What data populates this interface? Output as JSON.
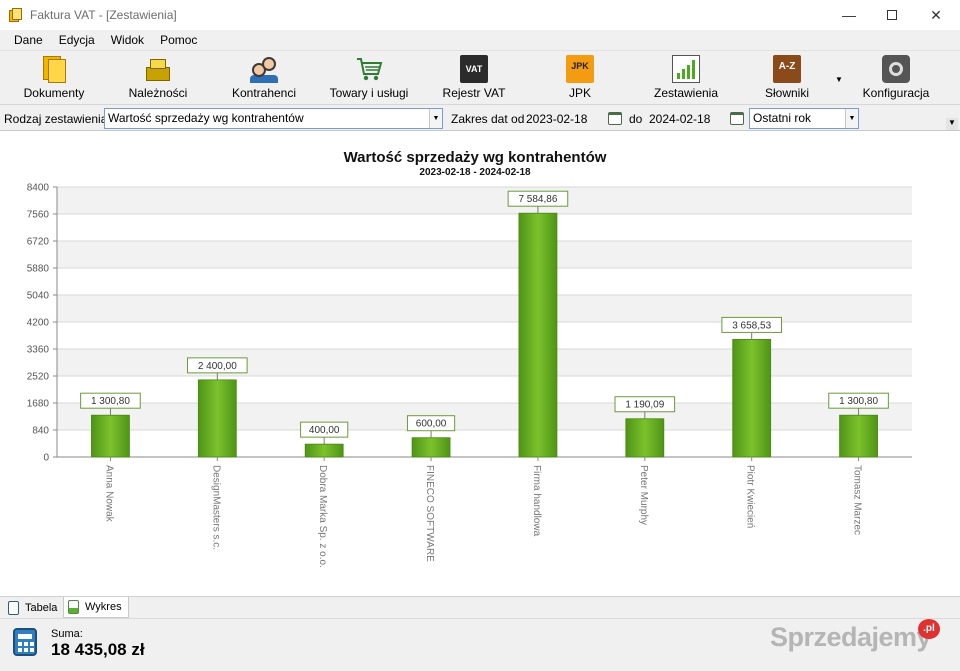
{
  "window": {
    "title": "Faktura VAT - [Zestawienia]",
    "min_glyph": "—",
    "close_glyph": "✕"
  },
  "menu": [
    "Dane",
    "Edycja",
    "Widok",
    "Pomoc"
  ],
  "toolbar": {
    "items": [
      {
        "label": "Dokumenty",
        "icon": "documents-icon"
      },
      {
        "label": "Należności",
        "icon": "money-icon"
      },
      {
        "label": "Kontrahenci",
        "icon": "contacts-icon"
      },
      {
        "label": "Towary i usługi",
        "icon": "cart-icon"
      },
      {
        "label": "Rejestr VAT",
        "icon": "vat-register-icon",
        "icon_text": "VAT"
      },
      {
        "label": "JPK",
        "icon": "jpk-icon",
        "icon_text": "JPK"
      },
      {
        "label": "Zestawienia",
        "icon": "report-icon"
      },
      {
        "label": "Słowniki",
        "icon": "dictionary-icon",
        "icon_text": "A-Z"
      },
      {
        "label": "Konfiguracja",
        "icon": "settings-icon"
      }
    ]
  },
  "filter": {
    "report_type_label": "Rodzaj zestawienia",
    "report_type_value": "Wartość sprzedaży wg kontrahentów",
    "range_from_label": "Zakres dat od",
    "date_from": "2023-02-18",
    "range_to_label": "do",
    "date_to": "2024-02-18",
    "period_value": "Ostatni rok"
  },
  "chart_data": {
    "type": "bar",
    "title": "Wartość sprzedaży wg kontrahentów",
    "subtitle": "2023-02-18 - 2024-02-18",
    "categories": [
      "Anna Nowak",
      "DesignMasters s.c.",
      "Dobra Marka Sp. z o.o.",
      "FINECO SOFTWARE",
      "Firma handlowa",
      "Peter Murphy",
      "Piotr Kwiecień",
      "Tomasz Marzec"
    ],
    "values": [
      1300.8,
      2400.0,
      400.0,
      600.0,
      7584.86,
      1190.09,
      3658.53,
      1300.8
    ],
    "value_labels": [
      "1 300,80",
      "2 400,00",
      "400,00",
      "600,00",
      "7 584,86",
      "1 190,09",
      "3 658,53",
      "1 300,80"
    ],
    "yticks": [
      "0",
      "840",
      "1680",
      "2520",
      "3360",
      "4200",
      "5040",
      "5880",
      "6720",
      "7560",
      "8400"
    ],
    "ylim": [
      0,
      8400
    ],
    "grid": true,
    "colors": {
      "bar": "#6ab023",
      "bar_dark": "#4a8a12",
      "label_border": "#6d9a3a",
      "band": "#f2f2f2"
    }
  },
  "tabs": [
    {
      "label": "Tabela",
      "icon": "table-icon"
    },
    {
      "label": "Wykres",
      "icon": "chart-icon"
    }
  ],
  "status": {
    "sum_label": "Suma:",
    "sum_value": "18 435,08 zł"
  },
  "watermark": {
    "text": "Sprzedajemy",
    "badge": ".pl"
  }
}
